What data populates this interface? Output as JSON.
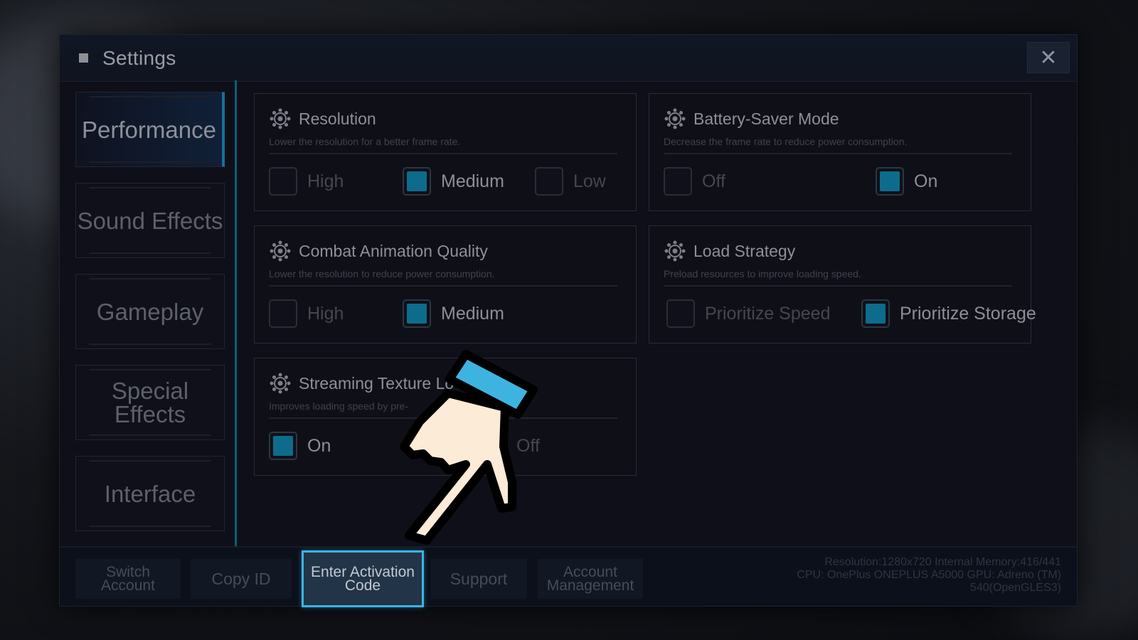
{
  "window": {
    "title": "Settings",
    "close_icon": "close-icon"
  },
  "sidebar": {
    "items": [
      {
        "label": "Performance",
        "active": true
      },
      {
        "label": "Sound Effects",
        "active": false
      },
      {
        "label": "Gameplay",
        "active": false
      },
      {
        "label": "Special\nEffects",
        "active": false
      },
      {
        "label": "Interface",
        "active": false
      }
    ]
  },
  "settings": [
    {
      "title": "Resolution",
      "icon": "gear-icon",
      "description": "Lower the resolution for a better frame rate.",
      "options": [
        {
          "label": "High",
          "checked": false
        },
        {
          "label": "Medium",
          "checked": true
        },
        {
          "label": "Low",
          "checked": false
        }
      ]
    },
    {
      "title": "Battery-Saver Mode",
      "icon": "gear-icon",
      "description": "Decrease the frame rate to reduce power consumption.",
      "options": [
        {
          "label": "Off",
          "checked": false
        },
        {
          "label": "On",
          "checked": true
        }
      ]
    },
    {
      "title": "Combat Animation Quality",
      "icon": "gear-icon",
      "description": "Lower the resolution to reduce power consumption.",
      "options": [
        {
          "label": "High",
          "checked": false
        },
        {
          "label": "Medium",
          "checked": true
        }
      ]
    },
    {
      "title": "Load Strategy",
      "icon": "gear-icon",
      "description": "Preload resources to improve loading speed.",
      "options": [
        {
          "label": "Prioritize Speed",
          "checked": false
        },
        {
          "label": "Prioritize Storage",
          "checked": true
        }
      ]
    },
    {
      "title": "Streaming Texture Lo",
      "icon": "gear-icon",
      "description": "Improves loading speed by pre-                        on textures.",
      "options": [
        {
          "label": "On",
          "checked": true
        },
        {
          "label": "Off",
          "checked": false
        }
      ]
    }
  ],
  "bottom_buttons": [
    {
      "label": "Switch\nAccount"
    },
    {
      "label": "Copy ID"
    },
    {
      "label": "Enter Activation\nCode",
      "highlighted": true
    },
    {
      "label": "Support"
    },
    {
      "label": "Account\nManagement"
    }
  ],
  "status": {
    "line1": "Resolution:1280x720  Internal Memory:416/441",
    "line2": "CPU:  OnePlus ONEPLUS A5000  GPU:  Adreno (TM)",
    "line3": "540(OpenGLES3)"
  },
  "overlay": {
    "pointer_icon": "pointing-hand-icon"
  },
  "colors": {
    "accent": "#0d6c8c",
    "highlight_border": "#3bb3e3",
    "hand_fill": "#fcebd6",
    "cuff": "#3db4e0"
  }
}
